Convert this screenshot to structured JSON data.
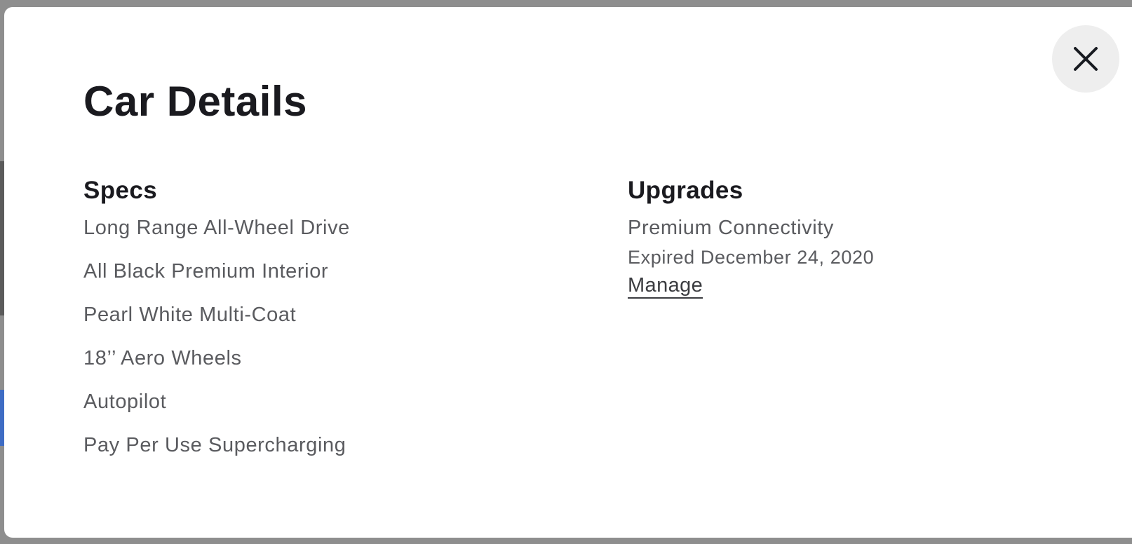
{
  "modal": {
    "title": "Car Details",
    "close_icon": "close-icon"
  },
  "specs": {
    "heading": "Specs",
    "items": [
      "Long Range All-Wheel Drive",
      "All Black Premium Interior",
      "Pearl White Multi-Coat",
      "18’’ Aero Wheels",
      "Autopilot",
      "Pay Per Use Supercharging"
    ]
  },
  "upgrades": {
    "heading": "Upgrades",
    "items": [
      {
        "name": "Premium Connectivity",
        "status": "Expired December 24, 2020",
        "action_label": "Manage"
      }
    ]
  },
  "colors": {
    "modal_background": "#ffffff",
    "backdrop": "#8e8e8e",
    "heading_text": "#1a1a1f",
    "body_text": "#5a5b5f",
    "close_button_bg": "#eeeeee"
  }
}
